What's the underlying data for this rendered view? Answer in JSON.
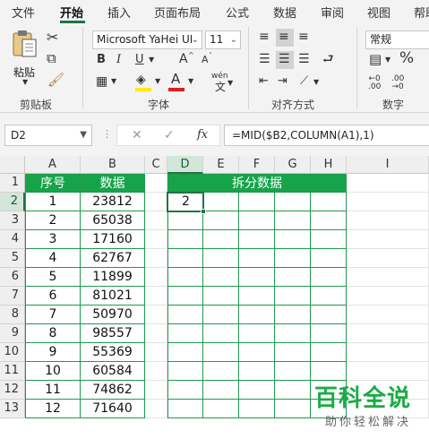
{
  "menu": {
    "tabs": [
      "文件",
      "开始",
      "插入",
      "页面布局",
      "公式",
      "数据",
      "审阅",
      "视图",
      "帮助"
    ],
    "active": "开始"
  },
  "ribbon": {
    "clipboard": {
      "paste_label": "粘贴",
      "group_label": "剪贴板"
    },
    "font": {
      "font_name": "Microsoft YaHei UI",
      "font_size": "11",
      "bold": "B",
      "italic": "I",
      "underline": "U",
      "grow": "A",
      "shrink": "A",
      "phonetic": "wén",
      "group_label": "字体",
      "fill_color": "#ffeb00",
      "font_color": "#e02020"
    },
    "alignment": {
      "group_label": "对齐方式"
    },
    "number": {
      "format": "常规",
      "percent": "%",
      "group_label": "数字"
    }
  },
  "formula_bar": {
    "name_box": "D2",
    "cancel": "✕",
    "enter": "✓",
    "fx": "fx",
    "formula": "=MID($B2,COLUMN(A1),1)"
  },
  "sheet": {
    "columns": [
      "A",
      "B",
      "C",
      "D",
      "E",
      "F",
      "G",
      "H",
      "I"
    ],
    "rows": [
      "1",
      "2",
      "3",
      "4",
      "5",
      "6",
      "7",
      "8",
      "9",
      "10",
      "11",
      "12",
      "13"
    ],
    "headers": {
      "seq": "序号",
      "data": "数据",
      "split": "拆分数据"
    },
    "table": [
      [
        "1",
        "23812"
      ],
      [
        "2",
        "65038"
      ],
      [
        "3",
        "17160"
      ],
      [
        "4",
        "62767"
      ],
      [
        "5",
        "11899"
      ],
      [
        "6",
        "81021"
      ],
      [
        "7",
        "50970"
      ],
      [
        "8",
        "98557"
      ],
      [
        "9",
        "55369"
      ],
      [
        "10",
        "60584"
      ],
      [
        "11",
        "74862"
      ],
      [
        "12",
        "71640"
      ]
    ],
    "selected_value": "2",
    "accent": "#217346",
    "header_fill": "#17a34a"
  },
  "watermark": {
    "title": "百科全说",
    "subtitle": "助你轻松解决"
  }
}
